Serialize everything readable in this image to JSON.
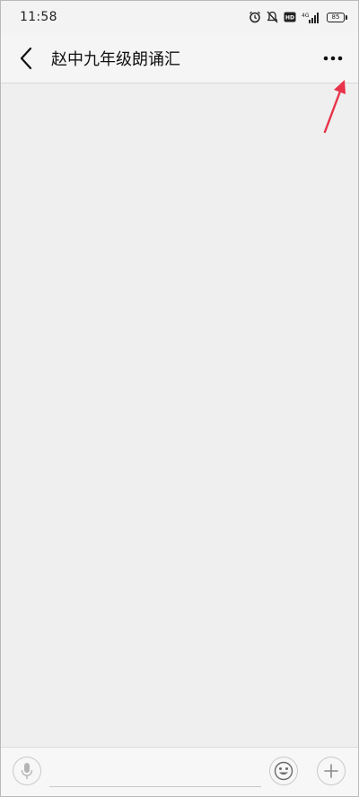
{
  "status_bar": {
    "time": "11:58",
    "network_label": "4G",
    "battery_level": "85",
    "icons": [
      "alarm-icon",
      "mute-icon",
      "hd-icon",
      "signal-icon",
      "battery-icon"
    ]
  },
  "nav": {
    "title": "赵中九年级朗诵汇",
    "back_icon": "chevron-left-icon",
    "more_icon": "more-dots-icon"
  },
  "annotation": {
    "color": "#e8334a"
  },
  "input_bar": {
    "input_value": "",
    "input_placeholder": "",
    "icons": [
      "microphone-icon",
      "emoji-icon",
      "plus-icon"
    ]
  }
}
